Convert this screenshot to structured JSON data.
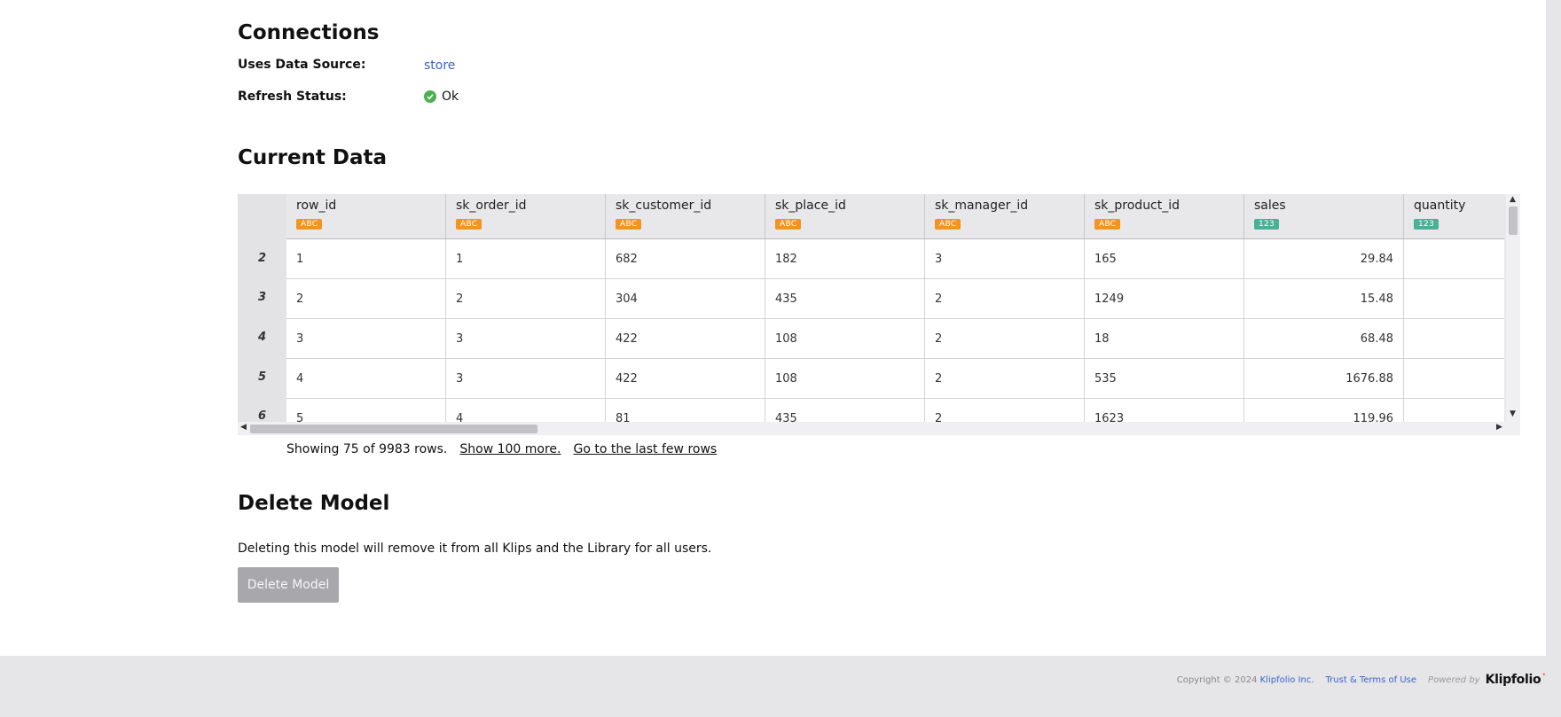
{
  "connections": {
    "title": "Connections",
    "data_source_label": "Uses Data Source:",
    "data_source_value": "store",
    "refresh_label": "Refresh Status:",
    "refresh_value": "Ok"
  },
  "current_data": {
    "title": "Current Data",
    "columns": [
      {
        "name": "row_id",
        "type": "ABC"
      },
      {
        "name": "sk_order_id",
        "type": "ABC"
      },
      {
        "name": "sk_customer_id",
        "type": "ABC"
      },
      {
        "name": "sk_place_id",
        "type": "ABC"
      },
      {
        "name": "sk_manager_id",
        "type": "ABC"
      },
      {
        "name": "sk_product_id",
        "type": "ABC"
      },
      {
        "name": "sales",
        "type": "123"
      },
      {
        "name": "quantity",
        "type": "123"
      }
    ],
    "rows": [
      {
        "num": "2",
        "cells": [
          "1",
          "1",
          "682",
          "182",
          "3",
          "165",
          "29.84",
          ""
        ]
      },
      {
        "num": "3",
        "cells": [
          "2",
          "2",
          "304",
          "435",
          "2",
          "1249",
          "15.48",
          ""
        ]
      },
      {
        "num": "4",
        "cells": [
          "3",
          "3",
          "422",
          "108",
          "2",
          "18",
          "68.48",
          ""
        ]
      },
      {
        "num": "5",
        "cells": [
          "4",
          "3",
          "422",
          "108",
          "2",
          "535",
          "1676.88",
          ""
        ]
      },
      {
        "num": "6",
        "cells": [
          "5",
          "4",
          "81",
          "435",
          "2",
          "1623",
          "119.96",
          ""
        ]
      }
    ],
    "showing_text": "Showing 75 of 9983 rows.",
    "show_more_link": "Show 100 more.",
    "last_rows_link": "Go to the last few rows"
  },
  "delete_model": {
    "title": "Delete Model",
    "description": "Deleting this model will remove it from all Klips and the Library for all users.",
    "button_label": "Delete Model"
  },
  "footer": {
    "copyright": "Copyright © 2024",
    "company_link": "Klipfolio Inc.",
    "terms_link": "Trust & Terms of Use",
    "powered_by": "Powered by",
    "brand": "Klipfolio"
  },
  "colors": {
    "badge_text": "#f29322",
    "badge_number": "#4bb097",
    "link": "#3a63c7",
    "ok": "#4caf50"
  }
}
